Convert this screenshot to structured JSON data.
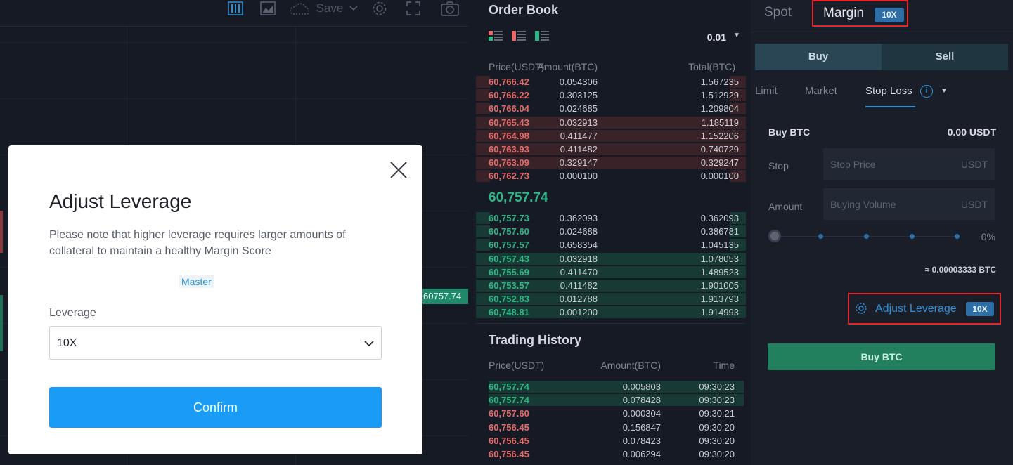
{
  "chart_toolbar": {
    "save_label": "Save",
    "icons": [
      "candles-icon",
      "area-chart-icon",
      "cloud-icon",
      "chevron-down-icon",
      "gear-icon",
      "fullscreen-icon",
      "camera-icon"
    ]
  },
  "chart": {
    "last_price_tag": "60757.74"
  },
  "order_book": {
    "title": "Order Book",
    "precision": "0.01",
    "headers": {
      "price": "Price(USDT)",
      "amount": "Amount(BTC)",
      "total": "Total(BTC)"
    },
    "asks": [
      {
        "price": "60,766.42",
        "amount": "0.054306",
        "total": "1.567235",
        "depth": 0.06
      },
      {
        "price": "60,766.22",
        "amount": "0.303125",
        "total": "1.512929",
        "depth": 0.06
      },
      {
        "price": "60,766.04",
        "amount": "0.024685",
        "total": "1.209804",
        "depth": 0.06
      },
      {
        "price": "60,765.43",
        "amount": "0.032913",
        "total": "1.185119",
        "depth": 1.0
      },
      {
        "price": "60,764.98",
        "amount": "0.411477",
        "total": "1.152206",
        "depth": 1.0
      },
      {
        "price": "60,763.93",
        "amount": "0.411482",
        "total": "0.740729",
        "depth": 1.0
      },
      {
        "price": "60,763.09",
        "amount": "0.329147",
        "total": "0.329247",
        "depth": 1.0
      },
      {
        "price": "60,762.73",
        "amount": "0.000100",
        "total": "0.000100",
        "depth": 0.06
      }
    ],
    "mid_price": "60,757.74",
    "bids": [
      {
        "price": "60,757.73",
        "amount": "0.362093",
        "total": "0.362093",
        "depth": 0.06
      },
      {
        "price": "60,757.60",
        "amount": "0.024688",
        "total": "0.386781",
        "depth": 0.06
      },
      {
        "price": "60,757.57",
        "amount": "0.658354",
        "total": "1.045135",
        "depth": 0.06
      },
      {
        "price": "60,757.43",
        "amount": "0.032918",
        "total": "1.078053",
        "depth": 1.0
      },
      {
        "price": "60,755.69",
        "amount": "0.411470",
        "total": "1.489523",
        "depth": 1.0
      },
      {
        "price": "60,753.57",
        "amount": "0.411482",
        "total": "1.901005",
        "depth": 1.0
      },
      {
        "price": "60,752.83",
        "amount": "0.012788",
        "total": "1.913793",
        "depth": 1.0
      },
      {
        "price": "60,748.81",
        "amount": "0.001200",
        "total": "1.914993",
        "depth": 1.0
      }
    ]
  },
  "trading_history": {
    "title": "Trading History",
    "headers": {
      "price": "Price(USDT)",
      "amount": "Amount(BTC)",
      "time": "Time"
    },
    "rows": [
      {
        "price": "60,757.74",
        "amount": "0.005803",
        "time": "09:30:23",
        "side": "buy"
      },
      {
        "price": "60,757.74",
        "amount": "0.078428",
        "time": "09:30:23",
        "side": "buy"
      },
      {
        "price": "60,757.60",
        "amount": "0.000304",
        "time": "09:30:21",
        "side": "sell"
      },
      {
        "price": "60,756.45",
        "amount": "0.156847",
        "time": "09:30:20",
        "side": "sell"
      },
      {
        "price": "60,756.45",
        "amount": "0.078423",
        "time": "09:30:20",
        "side": "sell"
      },
      {
        "price": "60,756.45",
        "amount": "0.006294",
        "time": "09:30:20",
        "side": "sell"
      }
    ]
  },
  "trade_panel": {
    "tabs": {
      "spot": "Spot",
      "margin": "Margin",
      "margin_leverage": "10X"
    },
    "side": {
      "buy": "Buy",
      "sell": "Sell"
    },
    "order_types": {
      "limit": "Limit",
      "market": "Market",
      "stop_loss": "Stop Loss",
      "info": "i"
    },
    "buy_label": "Buy BTC",
    "balance": "0.00 USDT",
    "stop": {
      "label": "Stop",
      "placeholder": "Stop Price",
      "unit": "USDT"
    },
    "amount": {
      "label": "Amount",
      "placeholder": "Buying Volume",
      "unit": "USDT"
    },
    "slider_percent": "0%",
    "slider_value": 0,
    "estimate": "≈ 0.00003333 BTC",
    "adjust_leverage": {
      "label": "Adjust Leverage",
      "badge": "10X"
    },
    "submit": "Buy BTC",
    "colors": {
      "buy": "#22805f",
      "accent": "#2e8fd6",
      "highlight": "#e3262b"
    }
  },
  "modal": {
    "title": "Adjust Leverage",
    "note": "Please note that higher leverage requires larger amounts of collateral to maintain a healthy Margin Score",
    "tier": "Master",
    "leverage_label": "Leverage",
    "leverage_value": "10X",
    "confirm": "Confirm",
    "colors": {
      "confirm": "#1a9cf6"
    }
  }
}
